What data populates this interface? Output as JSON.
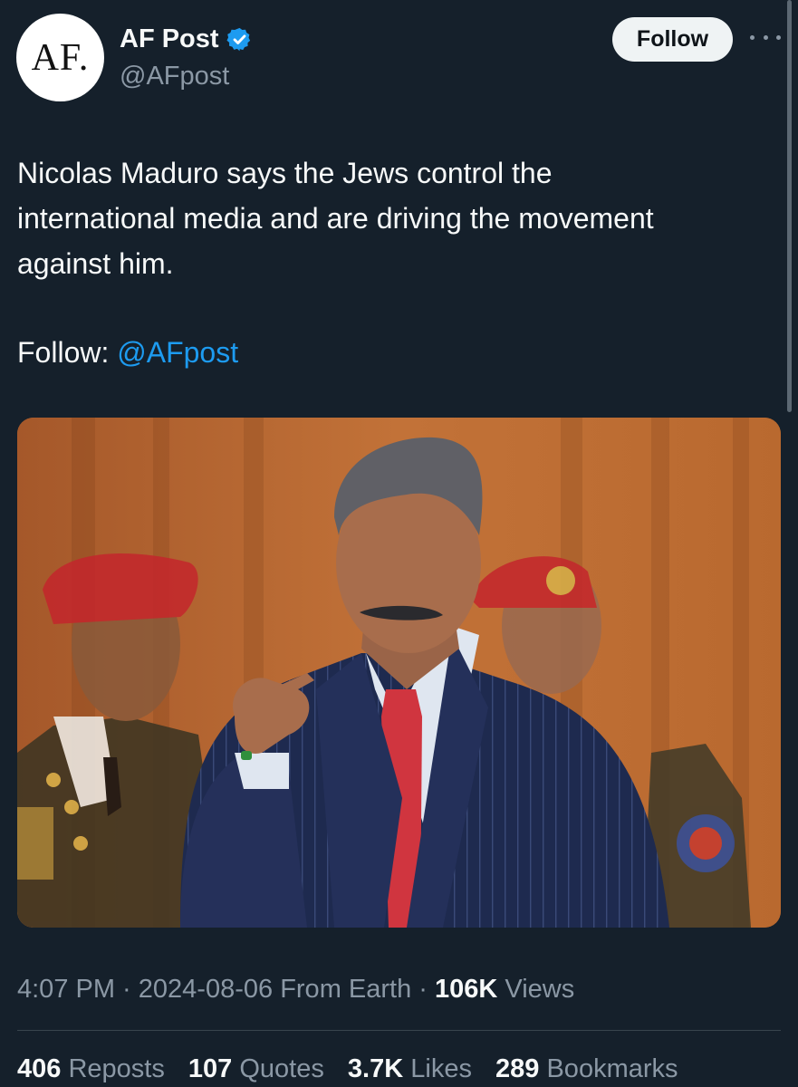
{
  "author": {
    "avatar_text": "AF.",
    "display_name": "AF Post",
    "handle": "@AFpost",
    "verified_icon": "verified-badge-icon"
  },
  "header": {
    "follow_label": "Follow",
    "more_icon": "more-horizontal-icon"
  },
  "tweet": {
    "text": "Nicolas Maduro says the Jews control the\ninternational media and are driving the movement\nagainst him.",
    "follow_prefix": "Follow: ",
    "mention": "@AFpost"
  },
  "meta": {
    "time": "4:07 PM",
    "separator": " · ",
    "date": "2024-08-06",
    "source": "From Earth",
    "views_count": "106K",
    "views_label": "Views"
  },
  "stats": {
    "reposts_count": "406",
    "reposts_label": "Reposts",
    "quotes_count": "107",
    "quotes_label": "Quotes",
    "likes_count": "3.7K",
    "likes_label": "Likes",
    "bookmarks_count": "289",
    "bookmarks_label": "Bookmarks"
  },
  "colors": {
    "background": "#15202b",
    "accent": "#1d9bf0",
    "muted": "#8b98a5"
  }
}
